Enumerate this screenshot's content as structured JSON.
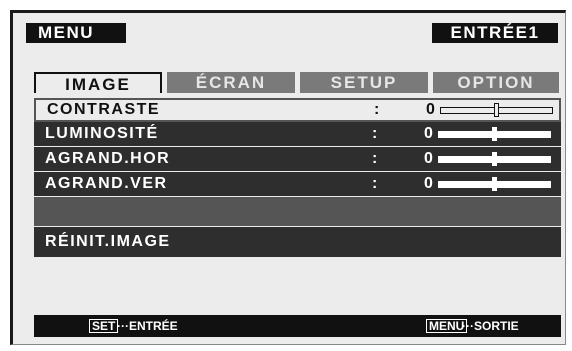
{
  "header": {
    "menu_title": "MENU",
    "input_label": "ENTRÉE1"
  },
  "tabs": [
    {
      "label": "IMAGE",
      "active": true
    },
    {
      "label": "ÉCRAN",
      "active": false
    },
    {
      "label": "SETUP",
      "active": false
    },
    {
      "label": "OPTION",
      "active": false
    }
  ],
  "items": [
    {
      "label": "CONTRASTE",
      "separator": ":",
      "value": "0",
      "level": 0.5
    },
    {
      "label": "LUMINOSITÉ",
      "separator": ":",
      "value": "0",
      "level": 0.5
    },
    {
      "label": "AGRAND.HOR",
      "separator": ":",
      "value": "0",
      "level": 0.5
    },
    {
      "label": "AGRAND.VER",
      "separator": ":",
      "value": "0",
      "level": 0.5
    },
    {
      "label": "RÉINIT.IMAGE"
    }
  ],
  "footer": {
    "set_key": "SET",
    "set_action": "···ENTRÉE",
    "menu_key": "MENU",
    "menu_action": "···SORTIE"
  },
  "colors": {
    "osd_background": "#ececec",
    "row_dark": "#2e2e2e",
    "row_blank": "#555555",
    "tab_inactive": "#7a7a7a",
    "title_bar": "#111111"
  }
}
